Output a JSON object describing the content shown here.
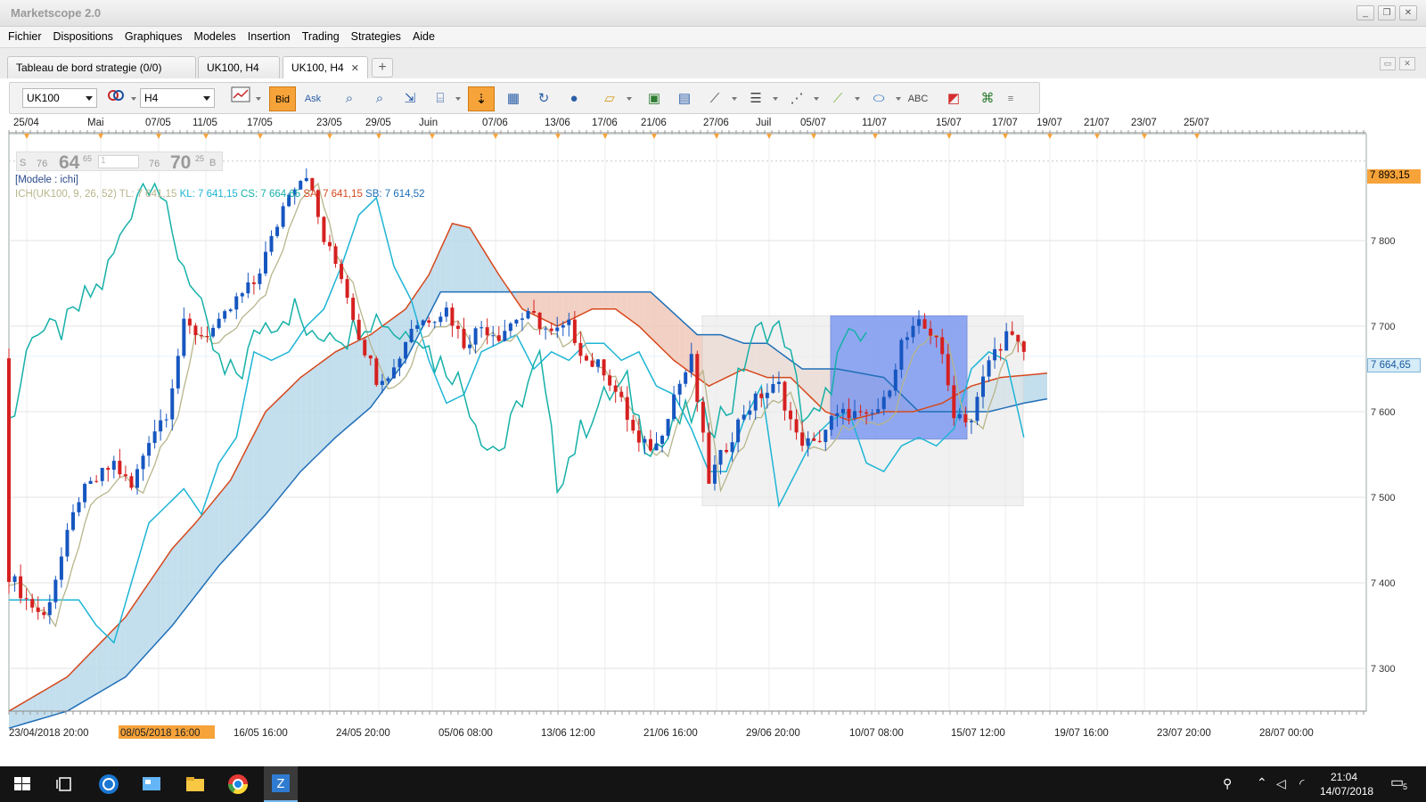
{
  "app": {
    "title": "Marketscope 2.0"
  },
  "window_controls": [
    "_",
    "❐",
    "✕"
  ],
  "menu": [
    "Fichier",
    "Dispositions",
    "Graphiques",
    "Modeles",
    "Insertion",
    "Trading",
    "Strategies",
    "Aide"
  ],
  "tabs": [
    {
      "label": "Tableau de bord strategie (0/0)"
    },
    {
      "label": "UK100, H4"
    },
    {
      "label": "UK100, H4",
      "close": "✕"
    }
  ],
  "tab_add": "+",
  "toolbar": {
    "instrument": "UK100",
    "timeframe": "H4",
    "bid_label": "Bid",
    "ask_label": "Ask"
  },
  "legend": {
    "s_label": "S",
    "s_small": "76",
    "s_big": "64",
    "s_sup": "65",
    "b_small": "76",
    "b_big": "70",
    "b_sup": "25",
    "b_label": "B",
    "s_input": "1",
    "model": "[Modele : ichi]",
    "ich_prefix": "ICH(UK100, 9, 26, 52)",
    "tl": "TL: 7 641,15",
    "kl": "KL: 7 641,15",
    "cs": "CS: 7 664,65",
    "sa": "SA: 7 641,15",
    "sb": "SB: 7 614,52"
  },
  "top_date_axis": [
    "25/04",
    "Mai",
    "07/05",
    "11/05",
    "17/05",
    "23/05",
    "29/05",
    "Juin",
    "07/06",
    "13/06",
    "17/06",
    "21/06",
    "27/06",
    "Juil",
    "05/07",
    "11/07",
    "15/07",
    "17/07",
    "19/07",
    "21/07",
    "23/07",
    "25/07"
  ],
  "bottom_date_axis": [
    "23/04/2018 20:00",
    "08/05/2018 16:00",
    "16/05 16:00",
    "24/05 20:00",
    "05/06 08:00",
    "13/06 12:00",
    "21/06 16:00",
    "29/06 20:00",
    "10/07 08:00",
    "15/07 12:00",
    "19/07 16:00",
    "23/07 20:00",
    "28/07 00:00"
  ],
  "price_axis": [
    "7 800",
    "7 700",
    "7 600",
    "7 500",
    "7 400",
    "7 300"
  ],
  "price_tags": {
    "high": "7 893,15",
    "current": "7 664,65"
  },
  "colors": {
    "tenkan": "#b7b58a",
    "kijun": "#1db5d5",
    "chikou": "#16b0a8",
    "span_a": "#d6481c",
    "span_b": "#1f6fb8",
    "cloud_bull": "#b8d8ea",
    "cloud_bear": "#f0c8b8",
    "candle_up": "#1656c0",
    "candle_down": "#d62020",
    "highlight_box": "#6f8ff0",
    "accent_orange": "#f6a33a"
  },
  "taskbar": {
    "time": "21:04",
    "date": "14/07/2018",
    "notif_count": "5"
  },
  "chart_data": {
    "type": "candlestick",
    "instrument": "UK100",
    "timeframe": "H4",
    "ylim": [
      7250,
      7925
    ],
    "close_path": [
      [
        0,
        7410
      ],
      [
        3,
        7380
      ],
      [
        6,
        7360
      ],
      [
        9,
        7430
      ],
      [
        12,
        7500
      ],
      [
        15,
        7520
      ],
      [
        18,
        7540
      ],
      [
        21,
        7510
      ],
      [
        24,
        7570
      ],
      [
        27,
        7600
      ],
      [
        30,
        7700
      ],
      [
        33,
        7690
      ],
      [
        36,
        7700
      ],
      [
        39,
        7730
      ],
      [
        42,
        7750
      ],
      [
        45,
        7800
      ],
      [
        48,
        7860
      ],
      [
        51,
        7880
      ],
      [
        54,
        7800
      ],
      [
        57,
        7760
      ],
      [
        60,
        7690
      ],
      [
        63,
        7640
      ],
      [
        66,
        7650
      ],
      [
        69,
        7700
      ],
      [
        72,
        7710
      ],
      [
        75,
        7720
      ],
      [
        78,
        7680
      ],
      [
        81,
        7700
      ],
      [
        84,
        7690
      ],
      [
        87,
        7710
      ],
      [
        90,
        7710
      ],
      [
        93,
        7690
      ],
      [
        96,
        7700
      ],
      [
        99,
        7660
      ],
      [
        102,
        7650
      ],
      [
        105,
        7610
      ],
      [
        108,
        7560
      ],
      [
        111,
        7560
      ],
      [
        114,
        7620
      ],
      [
        117,
        7660
      ],
      [
        120,
        7520
      ],
      [
        123,
        7560
      ],
      [
        126,
        7600
      ],
      [
        129,
        7620
      ],
      [
        132,
        7630
      ],
      [
        135,
        7570
      ],
      [
        138,
        7560
      ],
      [
        141,
        7590
      ],
      [
        144,
        7600
      ],
      [
        147,
        7590
      ],
      [
        150,
        7610
      ],
      [
        153,
        7680
      ],
      [
        156,
        7700
      ],
      [
        159,
        7690
      ],
      [
        162,
        7600
      ],
      [
        165,
        7590
      ],
      [
        168,
        7660
      ],
      [
        171,
        7690
      ],
      [
        174,
        7670
      ]
    ],
    "span_a_path": [
      [
        0,
        7250
      ],
      [
        10,
        7290
      ],
      [
        20,
        7360
      ],
      [
        28,
        7440
      ],
      [
        32,
        7470
      ],
      [
        38,
        7520
      ],
      [
        44,
        7600
      ],
      [
        50,
        7640
      ],
      [
        56,
        7670
      ],
      [
        62,
        7690
      ],
      [
        68,
        7720
      ],
      [
        72,
        7760
      ],
      [
        76,
        7820
      ],
      [
        79,
        7815
      ],
      [
        84,
        7760
      ],
      [
        88,
        7720
      ],
      [
        94,
        7700
      ],
      [
        100,
        7720
      ],
      [
        104,
        7720
      ],
      [
        108,
        7700
      ],
      [
        114,
        7660
      ],
      [
        120,
        7630
      ],
      [
        126,
        7650
      ],
      [
        130,
        7640
      ],
      [
        134,
        7640
      ],
      [
        140,
        7600
      ],
      [
        144,
        7590
      ],
      [
        150,
        7600
      ],
      [
        155,
        7600
      ],
      [
        160,
        7610
      ],
      [
        165,
        7630
      ],
      [
        170,
        7640
      ],
      [
        178,
        7645
      ]
    ],
    "span_b_path": [
      [
        0,
        7230
      ],
      [
        10,
        7250
      ],
      [
        20,
        7290
      ],
      [
        28,
        7350
      ],
      [
        36,
        7420
      ],
      [
        44,
        7480
      ],
      [
        50,
        7530
      ],
      [
        56,
        7570
      ],
      [
        62,
        7605
      ],
      [
        68,
        7660
      ],
      [
        74,
        7740
      ],
      [
        80,
        7740
      ],
      [
        90,
        7740
      ],
      [
        100,
        7740
      ],
      [
        110,
        7740
      ],
      [
        118,
        7690
      ],
      [
        122,
        7690
      ],
      [
        126,
        7680
      ],
      [
        130,
        7680
      ],
      [
        136,
        7650
      ],
      [
        142,
        7650
      ],
      [
        150,
        7640
      ],
      [
        156,
        7600
      ],
      [
        162,
        7600
      ],
      [
        168,
        7600
      ],
      [
        174,
        7610
      ],
      [
        178,
        7615
      ]
    ]
  }
}
